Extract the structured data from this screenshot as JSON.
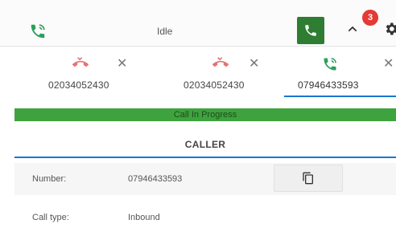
{
  "topbar": {
    "status_text": "Idle",
    "notification_count": "3",
    "icons": {
      "status": "phone-in-talk-icon",
      "call": "phone-icon",
      "toggle": "chevron-up-icon",
      "settings": "gear-icon"
    },
    "colors": {
      "call_button": "#2e7d32",
      "badge": "#e53935",
      "status_icon": "#2e9e5b"
    }
  },
  "tabs": [
    {
      "number": "02034052430",
      "state": "ended",
      "icon": "phone-hangup-icon",
      "active": false
    },
    {
      "number": "02034052430",
      "state": "ended",
      "icon": "phone-hangup-icon",
      "active": false
    },
    {
      "number": "07946433593",
      "state": "in-progress",
      "icon": "phone-in-talk-icon",
      "active": true
    }
  ],
  "call_status": {
    "text": "Call In Progress",
    "color": "#3ea33e"
  },
  "section": {
    "title": "CALLER"
  },
  "details": {
    "number_label": "Number:",
    "number_value": "07946433593",
    "copy_icon": "copy-icon",
    "call_type_label": "Call type:",
    "call_type_value": "Inbound"
  },
  "colors": {
    "accent": "#1976d2",
    "hangup": "#e57373"
  }
}
